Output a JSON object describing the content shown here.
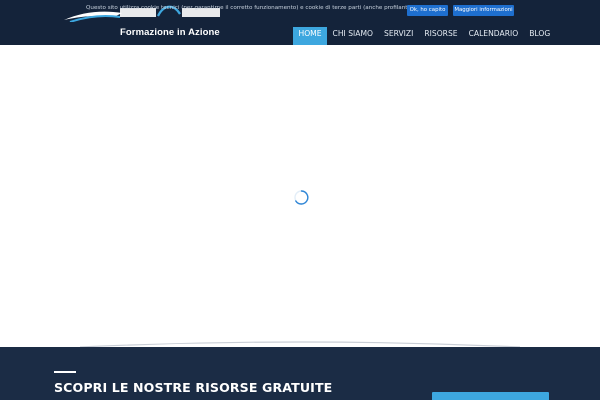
{
  "cookie_bar": {
    "text": "Questo sito utilizza cookie tecnici (per garantirne il corretto funzionamento) e cookie di terze parti (anche profilanti)",
    "accept_label": "Ok, ho capito",
    "more_info_label": "Maggiori informazioni"
  },
  "logo": {
    "tagline": "Formazione in Azione"
  },
  "nav": {
    "items": [
      {
        "label": "HOME",
        "active": true
      },
      {
        "label": "CHI SIAMO",
        "active": false
      },
      {
        "label": "SERVIZI",
        "active": false
      },
      {
        "label": "RISORSE",
        "active": false
      },
      {
        "label": "CALENDARIO",
        "active": false
      },
      {
        "label": "BLOG",
        "active": false
      }
    ]
  },
  "main": {
    "loading_icon": "spinner-icon"
  },
  "resources_section": {
    "title": "SCOPRI LE NOSTRE RISORSE GRATUITE"
  },
  "colors": {
    "header_bg": "#14233a",
    "accent": "#3da7df",
    "button_blue": "#1e6fcf",
    "footer_bg": "#1b2c45"
  }
}
